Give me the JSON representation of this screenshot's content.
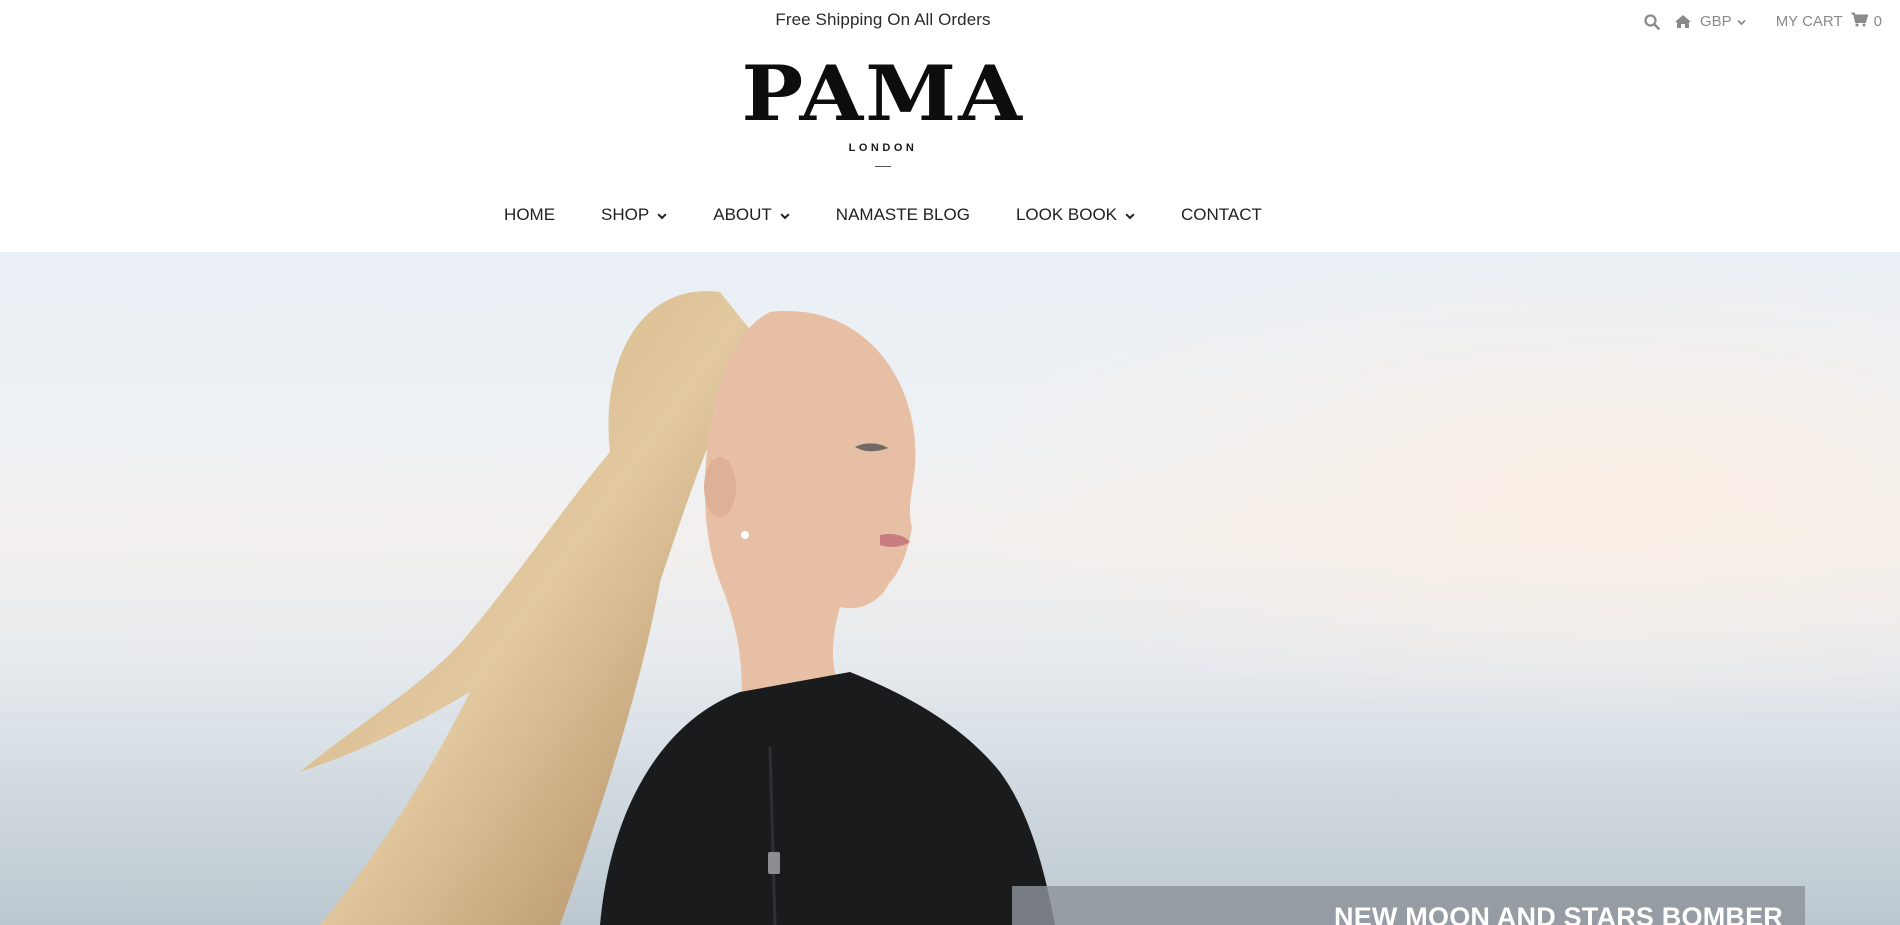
{
  "announcement": "Free Shipping On All Orders",
  "utility": {
    "search_icon": "search-icon",
    "home_icon": "home-icon",
    "currency": "GBP",
    "cart_label": "MY CART",
    "cart_count": "0"
  },
  "logo": {
    "word": "PAMA",
    "sub": "LONDON"
  },
  "nav": {
    "items": [
      {
        "label": "HOME"
      },
      {
        "label": "SHOP"
      },
      {
        "label": "ABOUT"
      },
      {
        "label": "NAMASTE BLOG"
      },
      {
        "label": "LOOK BOOK"
      },
      {
        "label": "CONTACT"
      }
    ]
  },
  "hero": {
    "caption": "NEW MOON AND STARS BOMBER"
  },
  "colors": {
    "text": "#1a1a1a",
    "muted": "#8a8a8a",
    "caption_bg": "#8c9298"
  }
}
